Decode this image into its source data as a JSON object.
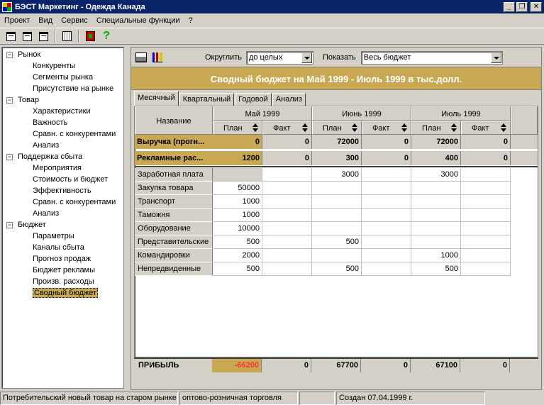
{
  "window": {
    "title": "БЭСТ Маркетинг - Одежда Канада"
  },
  "menu": [
    "Проект",
    "Вид",
    "Сервис",
    "Специальные функции",
    "?"
  ],
  "tree": [
    {
      "label": "Рынок",
      "items": [
        "Конкуренты",
        "Сегменты рынка",
        "Присутствие на рынке"
      ]
    },
    {
      "label": "Товар",
      "items": [
        "Характеристики",
        "Важность",
        "Сравн. с конкурентами",
        "Анализ"
      ]
    },
    {
      "label": "Поддержка сбыта",
      "items": [
        "Мероприятия",
        "Стоимость и бюджет",
        "Эффективность",
        "Сравн. с конкурентами",
        "Анализ"
      ]
    },
    {
      "label": "Бюджет",
      "items": [
        "Параметры",
        "Каналы сбыта",
        "Прогноз продаж",
        "Бюджет рекламы",
        "Произв. расходы",
        "Сводный бюджет"
      ]
    }
  ],
  "selected_item": "Сводный бюджет",
  "controls": {
    "round_label": "Округлить",
    "round_value": "до целых",
    "show_label": "Показать",
    "show_value": "Весь бюджет"
  },
  "banner": "Сводный бюджет на Май 1999 - Июль 1999 в тыс.долл.",
  "tabs": [
    "Месячный",
    "Квартальный",
    "Годовой",
    "Анализ"
  ],
  "active_tab": "Месячный",
  "grid": {
    "name_header": "Название",
    "months": [
      "Май 1999",
      "Июнь 1999",
      "Июль 1999"
    ],
    "sub_headers": [
      "План",
      "Факт"
    ],
    "summary_rows": [
      {
        "label": "Выручка (прогн...",
        "values": [
          "0",
          "0",
          "72000",
          "0",
          "72000",
          "0"
        ]
      },
      {
        "label": "Рекламные рас...",
        "values": [
          "1200",
          "0",
          "300",
          "0",
          "400",
          "0"
        ]
      }
    ],
    "rows": [
      {
        "label": "Заработная плата",
        "values": [
          "",
          "",
          "3000",
          "",
          "3000",
          ""
        ]
      },
      {
        "label": "Закупка товара",
        "values": [
          "50000",
          "",
          "",
          "",
          "",
          ""
        ]
      },
      {
        "label": "Транспорт",
        "values": [
          "1000",
          "",
          "",
          "",
          "",
          ""
        ]
      },
      {
        "label": "Таможня",
        "values": [
          "1000",
          "",
          "",
          "",
          "",
          ""
        ]
      },
      {
        "label": "Оборудование",
        "values": [
          "10000",
          "",
          "",
          "",
          "",
          ""
        ]
      },
      {
        "label": "Представительские",
        "values": [
          "500",
          "",
          "500",
          "",
          "",
          ""
        ]
      },
      {
        "label": "Командировки",
        "values": [
          "2000",
          "",
          "",
          "",
          "1000",
          ""
        ]
      },
      {
        "label": "Непредвиденные",
        "values": [
          "500",
          "",
          "500",
          "",
          "500",
          ""
        ]
      }
    ],
    "profit": {
      "label": "ПРИБЫЛЬ",
      "values": [
        "-66200",
        "0",
        "67700",
        "0",
        "67100",
        "0"
      ],
      "negative_color": "#ff3030"
    }
  },
  "status": [
    "Потребительский новый товар на старом рынке",
    "оптово-розничная торговля",
    "",
    "Создан 07.04.1999 г."
  ]
}
